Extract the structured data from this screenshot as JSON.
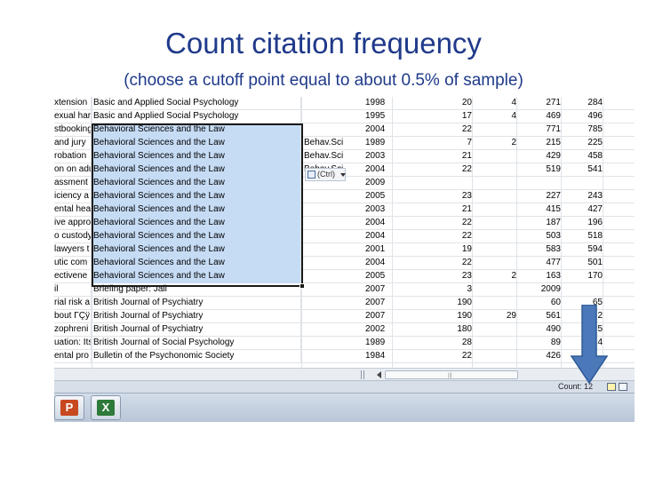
{
  "slide": {
    "title": "Count citation frequency",
    "subtitle": "(choose a cutoff point equal to about 0.5% of sample)"
  },
  "sheet": {
    "rows": [
      {
        "title": "xtension",
        "journal": "Basic and Applied Social Psychology",
        "abbr": "",
        "year": "1998",
        "n1": "20",
        "n2": "4",
        "n3": "271",
        "n4": "284",
        "selected": false
      },
      {
        "title": "exual har",
        "journal": "Basic and Applied Social Psychology",
        "abbr": "",
        "year": "1995",
        "n1": "17",
        "n2": "4",
        "n3": "469",
        "n4": "496",
        "selected": false
      },
      {
        "title": "stbooking",
        "journal": "Behavioral Sciences and the Law",
        "abbr": "",
        "year": "2004",
        "n1": "22",
        "n2": "",
        "n3": "771",
        "n4": "785",
        "selected": true
      },
      {
        "title": "and jury",
        "journal": "Behavioral Sciences and the Law",
        "abbr": "Behav.Sci.",
        "year": "1989",
        "n1": "7",
        "n2": "2",
        "n3": "215",
        "n4": "225",
        "selected": true
      },
      {
        "title": "robation",
        "journal": "Behavioral Sciences and the Law",
        "abbr": "Behav.Sci.",
        "year": "2003",
        "n1": "21",
        "n2": "",
        "n3": "429",
        "n4": "458",
        "selected": true
      },
      {
        "title": "on on adu",
        "journal": "Behavioral Sciences and the Law",
        "abbr": "Behav.Sci.",
        "year": "2004",
        "n1": "22",
        "n2": "",
        "n3": "519",
        "n4": "541",
        "selected": true
      },
      {
        "title": "assment",
        "journal": "Behavioral Sciences and the Law",
        "abbr": "",
        "year": "2009",
        "n1": "",
        "n2": "",
        "n3": "",
        "n4": "",
        "selected": true
      },
      {
        "title": "iciency a",
        "journal": "Behavioral Sciences and the Law",
        "abbr": "",
        "year": "2005",
        "n1": "23",
        "n2": "",
        "n3": "227",
        "n4": "243",
        "selected": true
      },
      {
        "title": "ental hea",
        "journal": "Behavioral Sciences and the Law",
        "abbr": "",
        "year": "2003",
        "n1": "21",
        "n2": "",
        "n3": "415",
        "n4": "427",
        "selected": true
      },
      {
        "title": "ive appro",
        "journal": "Behavioral Sciences and the Law",
        "abbr": "",
        "year": "2004",
        "n1": "22",
        "n2": "",
        "n3": "187",
        "n4": "196",
        "selected": true
      },
      {
        "title": "o custody",
        "journal": "Behavioral Sciences and the Law",
        "abbr": "",
        "year": "2004",
        "n1": "22",
        "n2": "",
        "n3": "503",
        "n4": "518",
        "selected": true
      },
      {
        "title": "lawyers t",
        "journal": "Behavioral Sciences and the Law",
        "abbr": "",
        "year": "2001",
        "n1": "19",
        "n2": "",
        "n3": "583",
        "n4": "594",
        "selected": true
      },
      {
        "title": "utic com",
        "journal": "Behavioral Sciences and the Law",
        "abbr": "",
        "year": "2004",
        "n1": "22",
        "n2": "",
        "n3": "477",
        "n4": "501",
        "selected": true
      },
      {
        "title": "ectivene",
        "journal": "Behavioral Sciences and the Law",
        "abbr": "",
        "year": "2005",
        "n1": "23",
        "n2": "2",
        "n3": "163",
        "n4": "170",
        "selected": true
      },
      {
        "title": "il",
        "journal": "Briefing paper: Jail",
        "abbr": "",
        "year": "2007",
        "n1": "3",
        "n2": "",
        "n3": "2009",
        "n4": "",
        "selected": false
      },
      {
        "title": "rial risk a",
        "journal": "British Journal of Psychiatry",
        "abbr": "",
        "year": "2007",
        "n1": "190",
        "n2": "",
        "n3": "60",
        "n4": "65",
        "selected": false
      },
      {
        "title": "bout ΓÇÿ",
        "journal": "British Journal of Psychiatry",
        "abbr": "",
        "year": "2007",
        "n1": "190",
        "n2": "29",
        "n3": "561",
        "n4": "2",
        "selected": false
      },
      {
        "title": "zophreni",
        "journal": "British Journal of Psychiatry",
        "abbr": "",
        "year": "2002",
        "n1": "180",
        "n2": "",
        "n3": "490",
        "n4": "5",
        "selected": false
      },
      {
        "title": "uation: Its",
        "journal": "British Journal of Social Psychology",
        "abbr": "",
        "year": "1989",
        "n1": "28",
        "n2": "",
        "n3": "89",
        "n4": "4",
        "selected": false
      },
      {
        "title": "ental pro",
        "journal": "Bulletin of the Psychonomic Society",
        "abbr": "",
        "year": "1984",
        "n1": "22",
        "n2": "",
        "n3": "426",
        "n4": "",
        "selected": false
      }
    ]
  },
  "paste_options": {
    "label": "(Ctrl)",
    "icon": "clipboard-icon"
  },
  "statusbar": {
    "count_label": "Count: 12"
  },
  "taskbar": {
    "apps": [
      {
        "name": "PowerPoint",
        "glyph": "P",
        "color": "#c8481f"
      },
      {
        "name": "Excel",
        "glyph": "X",
        "color": "#2e7a3a"
      }
    ]
  },
  "colors": {
    "title": "#1f3a8a",
    "selection": "#c6dcf5",
    "arrow": "#4a78b8"
  }
}
